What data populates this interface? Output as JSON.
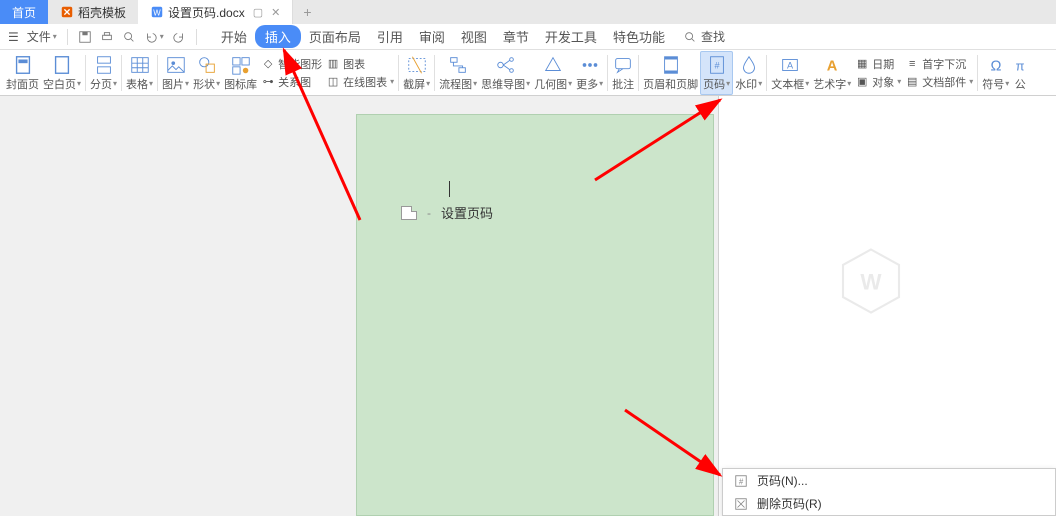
{
  "tabs": {
    "home": "首页",
    "template": "稻壳模板",
    "doc": "设置页码.docx"
  },
  "file_menu": "文件",
  "menu": {
    "start": "开始",
    "insert": "插入",
    "layout": "页面布局",
    "ref": "引用",
    "review": "审阅",
    "view": "视图",
    "chapter": "章节",
    "dev": "开发工具",
    "special": "特色功能"
  },
  "search": "查找",
  "ribbon": {
    "cover": "封面页",
    "blank": "空白页",
    "pagebreak": "分页",
    "table": "表格",
    "image": "图片",
    "shape": "形状",
    "iconlib": "图标库",
    "relation": "关系图",
    "smartshape": "智能图形",
    "chart": "图表",
    "onlinechart": "在线图表",
    "screenshot": "截屏",
    "flowchart": "流程图",
    "mindmap": "思维导图",
    "geometry": "几何图",
    "more": "更多",
    "comment": "批注",
    "headerfooter": "页眉和页脚",
    "pagenum": "页码",
    "watermark": "水印",
    "textbox": "文本框",
    "wordart": "艺术字",
    "date": "日期",
    "dropcap": "首字下沉",
    "object": "对象",
    "docparts": "文档部件",
    "symbol": "符号",
    "equation": "公"
  },
  "page_body": "设置页码",
  "context": {
    "pagenum": "页码(N)...",
    "delete": "删除页码(R)"
  }
}
